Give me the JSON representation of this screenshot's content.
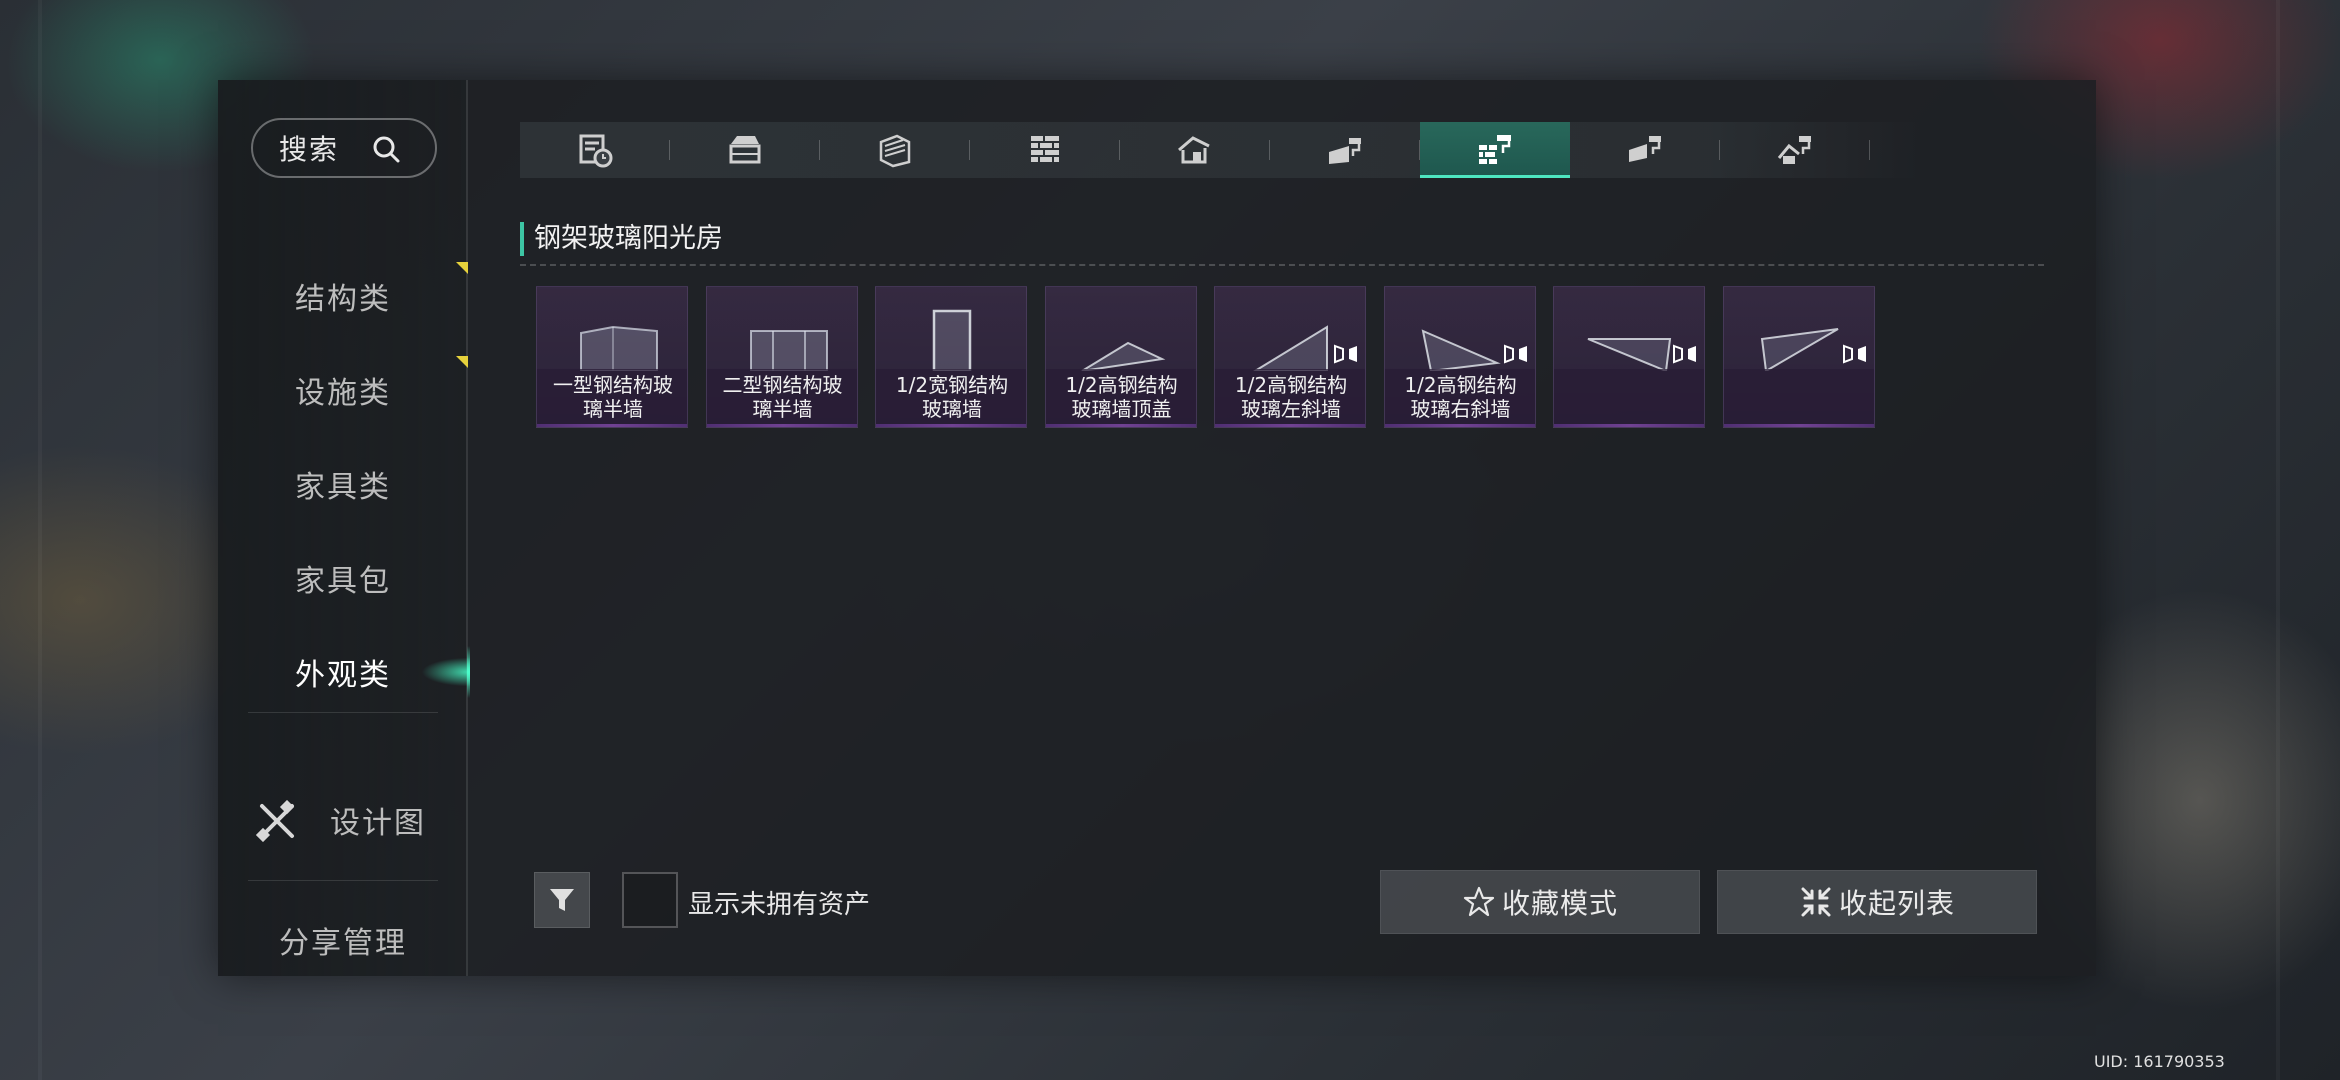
{
  "search": {
    "label": "搜索",
    "icon": "search-icon"
  },
  "sidebar": {
    "items": [
      {
        "label": "结构类",
        "flag": true
      },
      {
        "label": "设施类",
        "flag": true
      },
      {
        "label": "家具类",
        "flag": false
      },
      {
        "label": "家具包",
        "flag": false
      },
      {
        "label": "外观类",
        "flag": false,
        "active": true
      }
    ],
    "design": {
      "label": "设计图",
      "icon": "design-tools-icon"
    },
    "share": {
      "label": "分享管理"
    }
  },
  "tabs": [
    {
      "icon": "blueprint-clock-icon"
    },
    {
      "icon": "storage-box-icon"
    },
    {
      "icon": "wall-panel-icon"
    },
    {
      "icon": "brick-wall-icon"
    },
    {
      "icon": "house-roof-icon"
    },
    {
      "icon": "paint-wall-icon"
    },
    {
      "icon": "brick-roller-icon",
      "active": true
    },
    {
      "icon": "roller-wall-icon"
    },
    {
      "icon": "roller-roof-icon"
    }
  ],
  "section": {
    "title": "钢架玻璃阳光房"
  },
  "items": [
    {
      "name": "一型钢结构玻璃半墙",
      "line1": "一型钢结构玻",
      "line2": "璃半墙",
      "icon": "glass-half-wall-icon"
    },
    {
      "name": "二型钢结构玻璃半墙",
      "line1": "二型钢结构玻",
      "line2": "璃半墙",
      "icon": "glass-half-wall-2-icon"
    },
    {
      "name": "1/2宽钢结构玻璃墙",
      "line1": "1/2宽钢结构",
      "line2": "玻璃墙",
      "icon": "glass-narrow-wall-icon"
    },
    {
      "name": "1/2高钢结构玻璃墙顶盖",
      "line1": "1/2高钢结构",
      "line2": "玻璃墙顶盖",
      "icon": "glass-top-cap-icon"
    },
    {
      "name": "1/2高钢结构玻璃左斜墙",
      "line1": "1/2高钢结构",
      "line2": "玻璃左斜墙",
      "icon": "glass-left-slope-icon",
      "symmetric": true
    },
    {
      "name": "1/2高钢结构玻璃右斜墙",
      "line1": "1/2高钢结构",
      "line2": "玻璃右斜墙",
      "icon": "glass-right-slope-icon",
      "symmetric": true
    },
    {
      "name": "",
      "line1": "",
      "line2": "",
      "icon": "glass-triangle-icon",
      "symmetric": true
    },
    {
      "name": "",
      "line1": "",
      "line2": "",
      "icon": "glass-triangle-2-icon",
      "symmetric": true
    }
  ],
  "controls": {
    "filter_icon": "filter-icon",
    "show_unowned_label": "显示未拥有资产",
    "favorite_label": "收藏模式",
    "collapse_label": "收起列表"
  },
  "uid": "UID: 161790353",
  "colors": {
    "accent": "#3dc5a4",
    "flag": "#e6d23c",
    "tab_active": "#2a7a68",
    "item_bg": "#3c2c4a"
  }
}
